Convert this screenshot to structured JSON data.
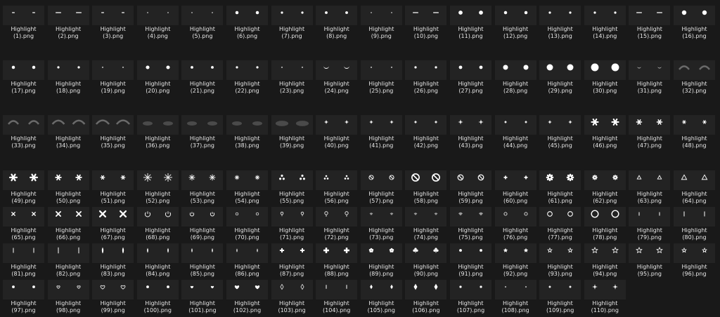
{
  "file_prefix": "Highlight",
  "file_ext": ".png",
  "items": [
    {
      "label": "Highlight (1).png",
      "icon": "dash-highlight-icon",
      "g": "dash",
      "s": 1
    },
    {
      "label": "Highlight (2).png",
      "icon": "dash-highlight-icon",
      "g": "dash",
      "s": 2
    },
    {
      "label": "Highlight (3).png",
      "icon": "dash-highlight-icon",
      "g": "dash",
      "s": 1
    },
    {
      "label": "Highlight (4).png",
      "icon": "faint-dot-highlight-icon",
      "g": "dot",
      "s": 0.6
    },
    {
      "label": "Highlight (5).png",
      "icon": "faint-dot-highlight-icon",
      "g": "dot",
      "s": 0.6
    },
    {
      "label": "Highlight (6).png",
      "icon": "dot-highlight-icon",
      "g": "dot",
      "s": 1.4
    },
    {
      "label": "Highlight (7).png",
      "icon": "dot-highlight-icon",
      "g": "dot",
      "s": 1
    },
    {
      "label": "Highlight (8).png",
      "icon": "dot-highlight-icon",
      "g": "dot",
      "s": 1.2
    },
    {
      "label": "Highlight (9).png",
      "icon": "faint-dot-highlight-icon",
      "g": "dot",
      "s": 0.6
    },
    {
      "label": "Highlight (10).png",
      "icon": "dash-highlight-icon",
      "g": "dash",
      "s": 2
    },
    {
      "label": "Highlight (11).png",
      "icon": "dot-highlight-icon",
      "g": "dot",
      "s": 1.8
    },
    {
      "label": "Highlight (12).png",
      "icon": "dot-highlight-icon",
      "g": "dot",
      "s": 1.4
    },
    {
      "label": "Highlight (13).png",
      "icon": "dot-highlight-icon",
      "g": "dot",
      "s": 1
    },
    {
      "label": "Highlight (14).png",
      "icon": "dot-highlight-icon",
      "g": "dot",
      "s": 1
    },
    {
      "label": "Highlight (15).png",
      "icon": "dash-highlight-icon",
      "g": "dash",
      "s": 2
    },
    {
      "label": "Highlight (16).png",
      "icon": "dot-highlight-icon",
      "g": "dot",
      "s": 2
    },
    {
      "label": "Highlight (17).png",
      "icon": "dot-highlight-icon",
      "g": "dot",
      "s": 1.4
    },
    {
      "label": "Highlight (18).png",
      "icon": "dot-highlight-icon",
      "g": "dot",
      "s": 1
    },
    {
      "label": "Highlight (19).png",
      "icon": "faint-dot-highlight-icon",
      "g": "dot",
      "s": 0.7
    },
    {
      "label": "Highlight (20).png",
      "icon": "dot-highlight-icon",
      "g": "dot",
      "s": 1.6
    },
    {
      "label": "Highlight (21).png",
      "icon": "dot-highlight-icon",
      "g": "dot",
      "s": 1.2
    },
    {
      "label": "Highlight (22).png",
      "icon": "dot-highlight-icon",
      "g": "dot",
      "s": 1
    },
    {
      "label": "Highlight (23).png",
      "icon": "faint-dot-highlight-icon",
      "g": "dot",
      "s": 0.7
    },
    {
      "label": "Highlight (24).png",
      "icon": "crescent-highlight-icon",
      "g": "crescent",
      "s": 1
    },
    {
      "label": "Highlight (25).png",
      "icon": "faint-dot-highlight-icon",
      "g": "dot",
      "s": 0.7
    },
    {
      "label": "Highlight (26).png",
      "icon": "dot-highlight-icon",
      "g": "dot",
      "s": 1
    },
    {
      "label": "Highlight (27).png",
      "icon": "dot-highlight-icon",
      "g": "dot",
      "s": 1.5
    },
    {
      "label": "Highlight (28).png",
      "icon": "dot-highlight-icon",
      "g": "dot",
      "s": 2.2
    },
    {
      "label": "Highlight (29).png",
      "icon": "dot-highlight-icon",
      "g": "dot",
      "s": 2.8
    },
    {
      "label": "Highlight (30).png",
      "icon": "dot-highlight-icon",
      "g": "dot",
      "s": 3.4
    },
    {
      "label": "Highlight (31).png",
      "icon": "crescent-highlight-icon",
      "g": "crescent",
      "s": 0.7
    },
    {
      "label": "Highlight (32).png",
      "icon": "soft-arc-highlight-icon",
      "g": "arc",
      "s": 1
    },
    {
      "label": "Highlight (33).png",
      "icon": "soft-arc-highlight-icon",
      "g": "arc",
      "s": 1
    },
    {
      "label": "Highlight (34).png",
      "icon": "soft-arc-highlight-icon",
      "g": "arc",
      "s": 1.2
    },
    {
      "label": "Highlight (35).png",
      "icon": "soft-arc-highlight-icon",
      "g": "arc",
      "s": 1.3
    },
    {
      "label": "Highlight (36).png",
      "icon": "soft-blob-highlight-icon",
      "g": "blob",
      "s": 1
    },
    {
      "label": "Highlight (37).png",
      "icon": "soft-blob-highlight-icon",
      "g": "blob",
      "s": 1
    },
    {
      "label": "Highlight (38).png",
      "icon": "soft-blob-highlight-icon",
      "g": "blob",
      "s": 1
    },
    {
      "label": "Highlight (39).png",
      "icon": "soft-blob-highlight-icon",
      "g": "blob",
      "s": 1.3
    },
    {
      "label": "Highlight (40).png",
      "icon": "sparkle-highlight-icon",
      "g": "sparkle",
      "s": 1
    },
    {
      "label": "Highlight (41).png",
      "icon": "sparkle-highlight-icon",
      "g": "sparkle",
      "s": 0.9
    },
    {
      "label": "Highlight (42).png",
      "icon": "sparkle-highlight-icon",
      "g": "sparkle",
      "s": 0.8
    },
    {
      "label": "Highlight (43).png",
      "icon": "sparkle-highlight-icon",
      "g": "sparkle",
      "s": 1.2
    },
    {
      "label": "Highlight (44).png",
      "icon": "sparkle-highlight-icon",
      "g": "sparkle",
      "s": 0.7
    },
    {
      "label": "Highlight (45).png",
      "icon": "sparkle-highlight-icon",
      "g": "sparkle",
      "s": 0.9
    },
    {
      "label": "Highlight (46).png",
      "icon": "snowflake-highlight-icon",
      "g": "snow",
      "s": 1.3
    },
    {
      "label": "Highlight (47).png",
      "icon": "snowflake-highlight-icon",
      "g": "snow",
      "s": 1
    },
    {
      "label": "Highlight (48).png",
      "icon": "snowflake-highlight-icon",
      "g": "snow",
      "s": 0.7
    },
    {
      "label": "Highlight (49).png",
      "icon": "snowflake-highlight-icon",
      "g": "snow",
      "s": 1.4
    },
    {
      "label": "Highlight (50).png",
      "icon": "snowflake-highlight-icon",
      "g": "snow",
      "s": 1.1
    },
    {
      "label": "Highlight (51).png",
      "icon": "snowflake-highlight-icon",
      "g": "snow",
      "s": 0.8
    },
    {
      "label": "Highlight (52).png",
      "icon": "asterisk-highlight-icon",
      "g": "asterisk",
      "s": 1.5
    },
    {
      "label": "Highlight (53).png",
      "icon": "asterisk-highlight-icon",
      "g": "asterisk",
      "s": 1.1
    },
    {
      "label": "Highlight (54).png",
      "icon": "asterisk-highlight-icon",
      "g": "asterisk",
      "s": 0.8
    },
    {
      "label": "Highlight (55).png",
      "icon": "trefoil-highlight-icon",
      "g": "trefoil",
      "s": 1.2
    },
    {
      "label": "Highlight (56).png",
      "icon": "trefoil-highlight-icon",
      "g": "trefoil",
      "s": 1
    },
    {
      "label": "Highlight (57).png",
      "icon": "no-sign-highlight-icon",
      "g": "nosign",
      "s": 0.9
    },
    {
      "label": "Highlight (58).png",
      "icon": "no-sign-highlight-icon",
      "g": "nosign",
      "s": 1.5
    },
    {
      "label": "Highlight (59).png",
      "icon": "no-sign-highlight-icon",
      "g": "nosign",
      "s": 1.1
    },
    {
      "label": "Highlight (60).png",
      "icon": "plus-highlight-icon",
      "g": "plus",
      "s": 0.9
    },
    {
      "label": "Highlight (61).png",
      "icon": "gear-highlight-icon",
      "g": "gear",
      "s": 1.4
    },
    {
      "label": "Highlight (62).png",
      "icon": "gear-highlight-icon",
      "g": "gear",
      "s": 1
    },
    {
      "label": "Highlight (63).png",
      "icon": "triangle-highlight-icon",
      "g": "triangle",
      "s": 0.9
    },
    {
      "label": "Highlight (64).png",
      "icon": "triangle-highlight-icon",
      "g": "triangle",
      "s": 1.2
    },
    {
      "label": "Highlight (65).png",
      "icon": "x-mark-highlight-icon",
      "g": "xmark",
      "s": 0.8
    },
    {
      "label": "Highlight (66).png",
      "icon": "x-mark-highlight-icon",
      "g": "xmark",
      "s": 1.1
    },
    {
      "label": "Highlight (67).png",
      "icon": "x-mark-highlight-icon",
      "g": "xmark",
      "s": 1.4
    },
    {
      "label": "Highlight (68).png",
      "icon": "power-highlight-icon",
      "g": "power",
      "s": 1.2
    },
    {
      "label": "Highlight (69).png",
      "icon": "power-highlight-icon",
      "g": "power",
      "s": 0.9
    },
    {
      "label": "Highlight (70).png",
      "icon": "small-ring-highlight-icon",
      "g": "ring",
      "s": 0.6
    },
    {
      "label": "Highlight (71).png",
      "icon": "bulb-highlight-icon",
      "g": "bulb",
      "s": 0.9
    },
    {
      "label": "Highlight (72).png",
      "icon": "bulb-highlight-icon",
      "g": "bulb",
      "s": 1.1
    },
    {
      "label": "Highlight (73).png",
      "icon": "wifi-highlight-icon",
      "g": "wifi",
      "s": 0.8
    },
    {
      "label": "Highlight (74).png",
      "icon": "wifi-highlight-icon",
      "g": "wifi",
      "s": 0.8
    },
    {
      "label": "Highlight (75).png",
      "icon": "wifi-highlight-icon",
      "g": "wifi",
      "s": 1
    },
    {
      "label": "Highlight (76).png",
      "icon": "small-ring-highlight-icon",
      "g": "ring",
      "s": 0.7
    },
    {
      "label": "Highlight (77).png",
      "icon": "ring-highlight-icon",
      "g": "ring",
      "s": 1.1
    },
    {
      "label": "Highlight (78).png",
      "icon": "ring-highlight-icon",
      "g": "ring",
      "s": 1.6
    },
    {
      "label": "Highlight (79).png",
      "icon": "line-highlight-icon",
      "g": "vline",
      "s": 0.7
    },
    {
      "label": "Highlight (80).png",
      "icon": "line-highlight-icon",
      "g": "vline",
      "s": 1
    },
    {
      "label": "Highlight (81).png",
      "icon": "line-highlight-icon",
      "g": "vline",
      "s": 1
    },
    {
      "label": "Highlight (82).png",
      "icon": "line-highlight-icon",
      "g": "vline",
      "s": 1.2
    },
    {
      "label": "Highlight (83).png",
      "icon": "drop-highlight-icon",
      "g": "drop",
      "s": 1.3
    },
    {
      "label": "Highlight (84).png",
      "icon": "drop-highlight-icon",
      "g": "drop",
      "s": 1
    },
    {
      "label": "Highlight (85).png",
      "icon": "drop-highlight-icon",
      "g": "drop",
      "s": 0.9
    },
    {
      "label": "Highlight (86).png",
      "icon": "drop-highlight-icon",
      "g": "drop",
      "s": 0.8
    },
    {
      "label": "Highlight (87).png",
      "icon": "cross-highlight-icon",
      "g": "plus",
      "s": 1.1
    },
    {
      "label": "Highlight (88).png",
      "icon": "cross-highlight-icon",
      "g": "plus",
      "s": 1.4
    },
    {
      "label": "Highlight (89).png",
      "icon": "flower-highlight-icon",
      "g": "flower",
      "s": 1
    },
    {
      "label": "Highlight (90).png",
      "icon": "club-highlight-icon",
      "g": "club",
      "s": 1.1
    },
    {
      "label": "Highlight (91).png",
      "icon": "dot-highlight-icon",
      "g": "dot",
      "s": 1.2
    },
    {
      "label": "Highlight (92).png",
      "icon": "star-highlight-icon",
      "g": "star",
      "s": 1
    },
    {
      "label": "Highlight (93).png",
      "icon": "star-outline-highlight-icon",
      "g": "starout",
      "s": 0.9
    },
    {
      "label": "Highlight (94).png",
      "icon": "star-outline-highlight-icon",
      "g": "starout",
      "s": 1.2
    },
    {
      "label": "Highlight (95).png",
      "icon": "star-outline-highlight-icon",
      "g": "starout",
      "s": 1.2
    },
    {
      "label": "Highlight (96).png",
      "icon": "star-outline-highlight-icon",
      "g": "starout",
      "s": 0.9
    },
    {
      "label": "Highlight (97).png",
      "icon": "dot-highlight-icon",
      "g": "dot",
      "s": 1.2
    },
    {
      "label": "Highlight (98).png",
      "icon": "heart-outline-highlight-icon",
      "g": "heartout",
      "s": 0.8
    },
    {
      "label": "Highlight (99).png",
      "icon": "heart-outline-highlight-icon",
      "g": "heartout",
      "s": 1.1
    },
    {
      "label": "Highlight (100).png",
      "icon": "dot-highlight-icon",
      "g": "dot",
      "s": 1.2
    },
    {
      "label": "Highlight (101).png",
      "icon": "heart-highlight-icon",
      "g": "heart",
      "s": 0.8
    },
    {
      "label": "Highlight (102).png",
      "icon": "heart-highlight-icon",
      "g": "heart",
      "s": 1.2
    },
    {
      "label": "Highlight (103).png",
      "icon": "diamond-outline-highlight-icon",
      "g": "diamondout",
      "s": 1
    },
    {
      "label": "Highlight (104).png",
      "icon": "line-highlight-icon",
      "g": "vline",
      "s": 0.8
    },
    {
      "label": "Highlight (105).png",
      "icon": "diamond-highlight-icon",
      "g": "diamond",
      "s": 0.9
    },
    {
      "label": "Highlight (106).png",
      "icon": "diamond-highlight-icon",
      "g": "diamond",
      "s": 1.2
    },
    {
      "label": "Highlight (107).png",
      "icon": "dot-highlight-icon",
      "g": "dot",
      "s": 1
    },
    {
      "label": "Highlight (108).png",
      "icon": "faint-dot-highlight-icon",
      "g": "dot",
      "s": 0.7
    },
    {
      "label": "Highlight (109).png",
      "icon": "sparkle-highlight-icon",
      "g": "sparkle",
      "s": 0.7
    },
    {
      "label": "Highlight (110).png",
      "icon": "sparkle-highlight-icon",
      "g": "sparkle",
      "s": 1.3
    }
  ]
}
